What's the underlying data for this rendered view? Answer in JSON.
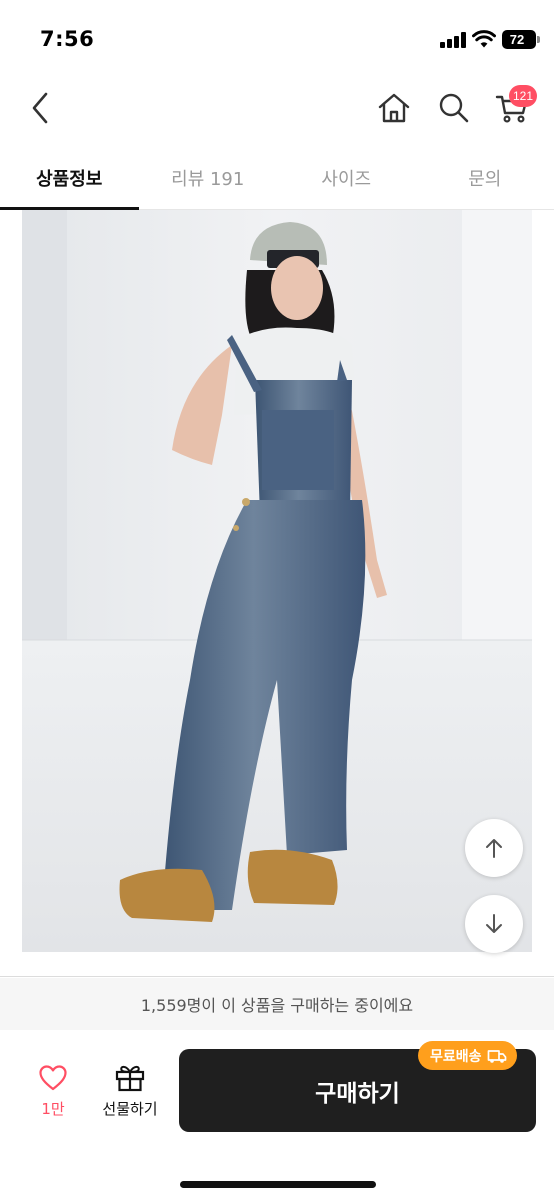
{
  "status_bar": {
    "time": "7:56",
    "battery": "72"
  },
  "nav": {
    "cart_badge": "121"
  },
  "tabs": [
    {
      "label": "상품정보",
      "active": true
    },
    {
      "label": "리뷰 191",
      "active": false
    },
    {
      "label": "사이즈",
      "active": false
    },
    {
      "label": "문의",
      "active": false
    }
  ],
  "buying_notice": "1,559명이 이 상품을 구매하는 중이에요",
  "bottom_bar": {
    "like_count": "1만",
    "gift_label": "선물하기",
    "buy_label": "구매하기",
    "free_shipping_label": "무료배송"
  },
  "colors": {
    "accent": "#ff4e63",
    "buy_button": "#1f1f1f",
    "free_shipping_badge": "#ff9f1c"
  },
  "icons": [
    "back-icon",
    "home-icon",
    "search-icon",
    "cart-icon",
    "arrow-up-icon",
    "arrow-down-icon",
    "heart-icon",
    "gift-icon",
    "truck-icon"
  ]
}
